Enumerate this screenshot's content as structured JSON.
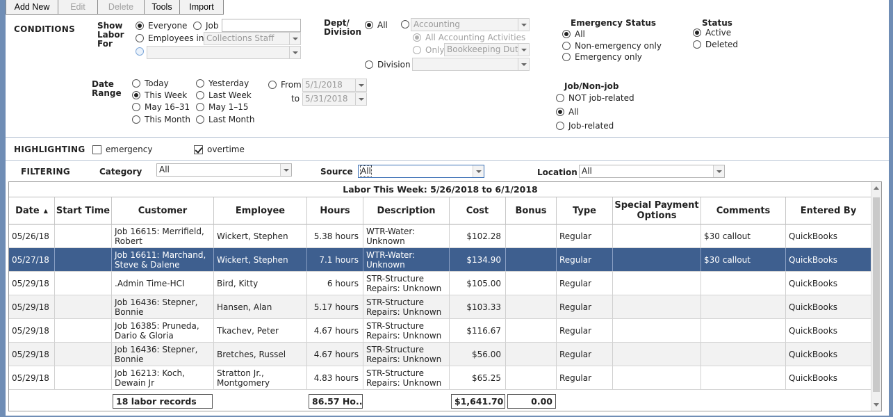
{
  "toolbar": {
    "add_new": "Add New",
    "edit": "Edit",
    "delete": "Delete",
    "tools": "Tools",
    "import": "Import"
  },
  "conditions": {
    "title": "CONDITIONS",
    "show_labor_for": {
      "label": "Show Labor For",
      "everyone": "Everyone",
      "job": "Job",
      "job_value": "",
      "employees_in": "Employees in",
      "employees_in_value": "Collections Staff",
      "third_value": ""
    },
    "dept": {
      "label": "Dept/ Division",
      "all": "All",
      "dept_value": "Accounting",
      "all_activities": "All Accounting Activities",
      "only": "Only",
      "only_value": "Bookkeeping Dut",
      "division": "Division",
      "division_value": ""
    },
    "emergency": {
      "label": "Emergency Status",
      "all": "All",
      "non_emergency": "Non-emergency only",
      "emergency_only": "Emergency only"
    },
    "status": {
      "label": "Status",
      "active": "Active",
      "deleted": "Deleted"
    },
    "date_range": {
      "label": "Date Range",
      "today": "Today",
      "yesterday": "Yesterday",
      "this_week": "This Week",
      "last_week": "Last Week",
      "may16_31": "May 16–31",
      "may1_15": "May 1–15",
      "this_month": "This Month",
      "last_month": "Last Month",
      "from": "From",
      "from_value": "5/1/2018",
      "to": "to",
      "to_value": "5/31/2018"
    },
    "job_nonjob": {
      "label": "Job/Non-job",
      "not_job": "NOT job-related",
      "all": "All",
      "job": "Job-related"
    }
  },
  "highlighting": {
    "title": "HIGHLIGHTING",
    "emergency": "emergency",
    "overtime": "overtime"
  },
  "filtering": {
    "title": "FILTERING",
    "category_label": "Category",
    "category_value": "All",
    "source_label": "Source",
    "source_value": "All",
    "location_label": "Location",
    "location_value": "All"
  },
  "grid": {
    "title": "Labor This Week: 5/26/2018 to 6/1/2018",
    "columns": [
      "Date",
      "Start Time",
      "Customer",
      "Employee",
      "Hours",
      "Description",
      "Cost",
      "Bonus",
      "Type",
      "Special Payment Options",
      "Comments",
      "Entered By"
    ],
    "rows": [
      {
        "date": "05/26/18",
        "start": "",
        "customer": "Job 16615: Merrifield, Robert",
        "employee": "Wickert, Stephen",
        "hours": "5.38 hours",
        "description": "WTR-Water: Unknown",
        "cost": "$102.28",
        "bonus": "",
        "type": "Regular",
        "special": "",
        "comments": "$30 callout",
        "entered_by": "QuickBooks"
      },
      {
        "date": "05/27/18",
        "start": "",
        "customer": "Job 16611: Marchand, Steve & Dalene",
        "employee": "Wickert, Stephen",
        "hours": "7.1 hours",
        "description": "WTR-Water: Unknown",
        "cost": "$134.90",
        "bonus": "",
        "type": "Regular",
        "special": "",
        "comments": "$30 callout",
        "entered_by": "QuickBooks"
      },
      {
        "date": "05/29/18",
        "start": "",
        "customer": ".Admin Time-HCI",
        "employee": "Bird, Kitty",
        "hours": "6 hours",
        "description": "STR-Structure Repairs: Unknown",
        "cost": "$105.00",
        "bonus": "",
        "type": "Regular",
        "special": "",
        "comments": "",
        "entered_by": "QuickBooks"
      },
      {
        "date": "05/29/18",
        "start": "",
        "customer": "Job 16436: Stepner, Bonnie",
        "employee": "Hansen, Alan",
        "hours": "5.17 hours",
        "description": "STR-Structure Repairs: Unknown",
        "cost": "$103.33",
        "bonus": "",
        "type": "Regular",
        "special": "",
        "comments": "",
        "entered_by": "QuickBooks"
      },
      {
        "date": "05/29/18",
        "start": "",
        "customer": "Job 16385: Pruneda, Dario & Gloria",
        "employee": "Tkachev, Peter",
        "hours": "4.67 hours",
        "description": "STR-Structure Repairs: Unknown",
        "cost": "$116.67",
        "bonus": "",
        "type": "Regular",
        "special": "",
        "comments": "",
        "entered_by": "QuickBooks"
      },
      {
        "date": "05/29/18",
        "start": "",
        "customer": "Job 16436: Stepner, Bonnie",
        "employee": "Bretches, Russel",
        "hours": "4.67 hours",
        "description": "STR-Structure Repairs: Unknown",
        "cost": "$56.00",
        "bonus": "",
        "type": "Regular",
        "special": "",
        "comments": "",
        "entered_by": "QuickBooks"
      },
      {
        "date": "05/29/18",
        "start": "",
        "customer": "Job 16213: Koch, Dewain Jr",
        "employee": "Stratton Jr., Montgomery",
        "hours": "4.83 hours",
        "description": "STR-Structure Repairs: Unknown",
        "cost": "$65.25",
        "bonus": "",
        "type": "Regular",
        "special": "",
        "comments": "",
        "entered_by": "QuickBooks"
      }
    ],
    "totals": {
      "records": "18 labor records",
      "hours": "86.57 Ho...",
      "cost": "$1,641.70",
      "bonus": "0.00"
    }
  }
}
